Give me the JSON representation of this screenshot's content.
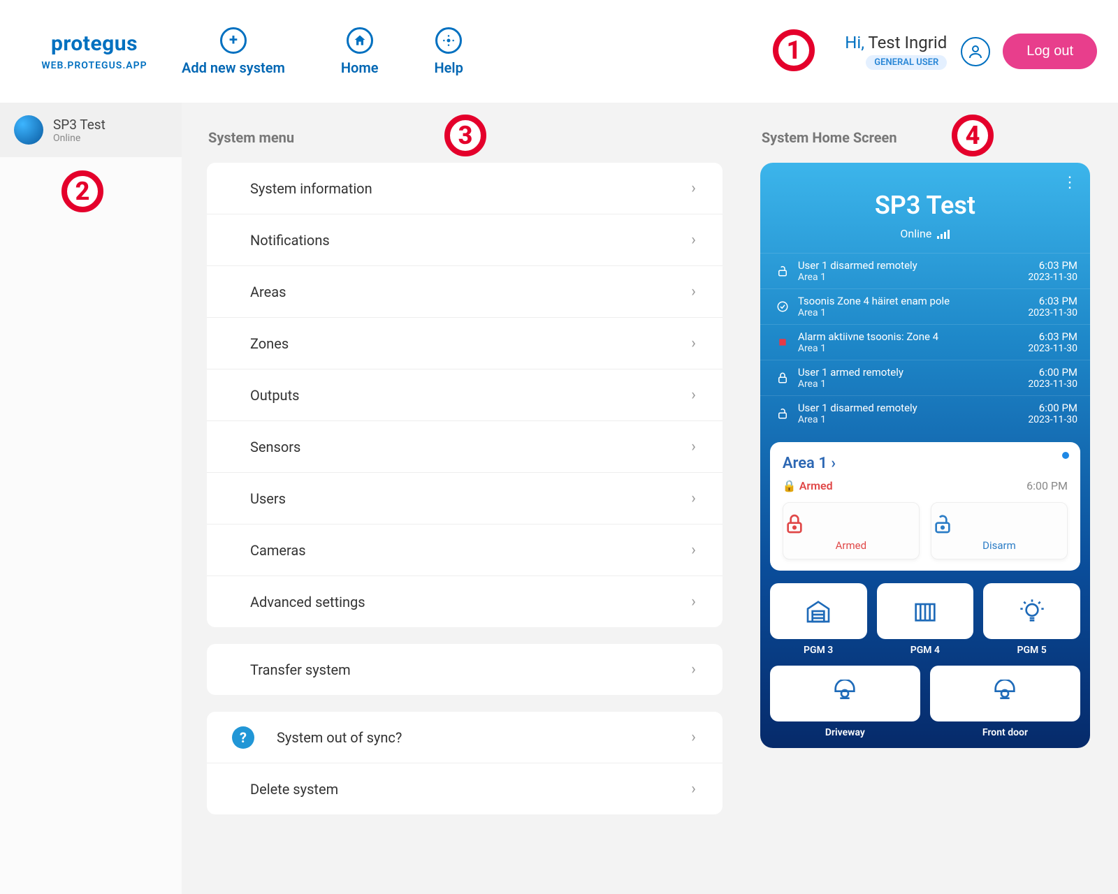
{
  "brand": {
    "name": "protegus",
    "sub": "WEB.PROTEGUS.APP"
  },
  "header": {
    "add": "Add new system",
    "home": "Home",
    "help": "Help",
    "hi": "Hi,",
    "user": "Test Ingrid",
    "role": "GENERAL USER",
    "logout": "Log out"
  },
  "sidebar": {
    "system": {
      "name": "SP3 Test",
      "status": "Online"
    }
  },
  "menu": {
    "title": "System menu",
    "group1": [
      "System information",
      "Notifications",
      "Areas",
      "Zones",
      "Outputs",
      "Sensors",
      "Users",
      "Cameras",
      "Advanced settings"
    ],
    "group2": [
      "Transfer system"
    ],
    "group3": [
      "System out of sync?",
      "Delete system"
    ]
  },
  "home": {
    "title": "System Home Screen",
    "card": {
      "name": "SP3 Test",
      "status": "Online"
    },
    "events": [
      {
        "icon": "unlock",
        "text": "User 1 disarmed remotely",
        "sub": "Area 1",
        "time": "6:03 PM",
        "date": "2023-11-30"
      },
      {
        "icon": "check",
        "text": "Tsoonis Zone 4 häiret enam pole",
        "sub": "Area 1",
        "time": "6:03 PM",
        "date": "2023-11-30"
      },
      {
        "icon": "alarm",
        "text": "Alarm aktiivne tsoonis: Zone 4",
        "sub": "Area 1",
        "time": "6:03 PM",
        "date": "2023-11-30"
      },
      {
        "icon": "lock",
        "text": "User 1 armed remotely",
        "sub": "Area 1",
        "time": "6:00 PM",
        "date": "2023-11-30"
      },
      {
        "icon": "unlock",
        "text": "User 1 disarmed remotely",
        "sub": "Area 1",
        "time": "6:00 PM",
        "date": "2023-11-30"
      }
    ],
    "area": {
      "name": "Area 1",
      "state": "Armed",
      "time": "6:00 PM",
      "btn_armed": "Armed",
      "btn_disarm": "Disarm"
    },
    "pgm_row1": [
      {
        "label": "PGM 3",
        "icon": "garage"
      },
      {
        "label": "PGM 4",
        "icon": "gate"
      },
      {
        "label": "PGM 5",
        "icon": "bulb"
      }
    ],
    "pgm_row2": [
      {
        "label": "Driveway",
        "icon": "camera"
      },
      {
        "label": "Front door",
        "icon": "camera"
      }
    ]
  },
  "callouts": {
    "c1": "1",
    "c2": "2",
    "c3": "3",
    "c4": "4"
  }
}
